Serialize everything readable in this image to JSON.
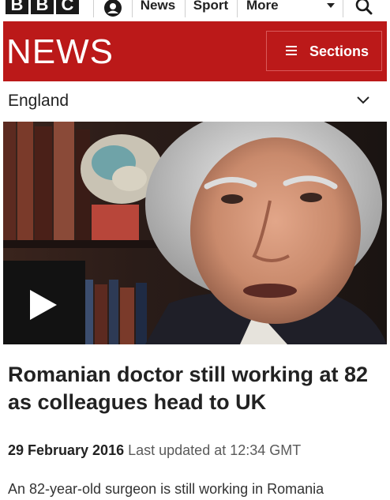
{
  "topbar": {
    "logo_letters": [
      "B",
      "B",
      "C"
    ],
    "nav": [
      "News",
      "Sport",
      "More"
    ],
    "account_icon": "account-icon",
    "search_icon": "search-icon"
  },
  "header": {
    "title": "NEWS",
    "sections_label": "Sections",
    "color": "#bb1919"
  },
  "region": {
    "label": "England"
  },
  "article": {
    "headline": "Romanian doctor still working at 82 as colleagues head to UK",
    "date": "29 February 2016",
    "updated_label": "Last updated at",
    "updated_time": "12:34 GMT",
    "summary": "An 82-year-old surgeon is still working in Romania"
  }
}
